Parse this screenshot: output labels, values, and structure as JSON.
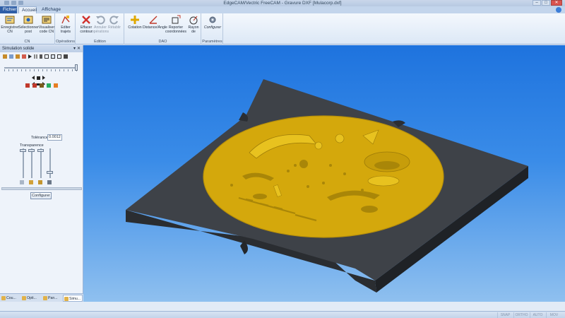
{
  "window": {
    "title": "EdgeCAM/Vectric FreeCAM - Gravure DXF [Mulacorp.dxf]"
  },
  "ribbon_tabs": [
    "Fichier",
    "Accueil",
    "Affichage"
  ],
  "ribbon": {
    "cn": {
      "label": "CN",
      "buttons": [
        "Enregistrer CN",
        "Sélectionner post",
        "Visualiser code CN"
      ]
    },
    "operations": {
      "label": "Opérations",
      "buttons": [
        "Editer trajets"
      ]
    },
    "edition": {
      "label": "Edition",
      "buttons": [
        "Effacer contour",
        "Annuler opérations",
        "Rétablir"
      ]
    },
    "dao": {
      "label": "DAO",
      "buttons": [
        "Cotation",
        "Distance/Angle",
        "Reporter coordonnées",
        "Rayon de"
      ]
    },
    "parametres": {
      "label": "Paramètres",
      "buttons": [
        "Configurer"
      ]
    }
  },
  "panel": {
    "title": "Simulation solide",
    "tolerance_label": "Tolérance",
    "tolerance_value": "0.0012",
    "transparence_label": "Transparence",
    "configure_button": "Configurer"
  },
  "bottom_tabs": [
    "Cou...",
    "Opti...",
    "Pan...",
    "Simu..."
  ],
  "statusbar": [
    "SNAP",
    "ORTHO",
    "AUTO",
    "MOV"
  ],
  "colors": {
    "background_top": "#1e73de",
    "stock": "#3b3f44",
    "engraving": "#d4a80c"
  }
}
